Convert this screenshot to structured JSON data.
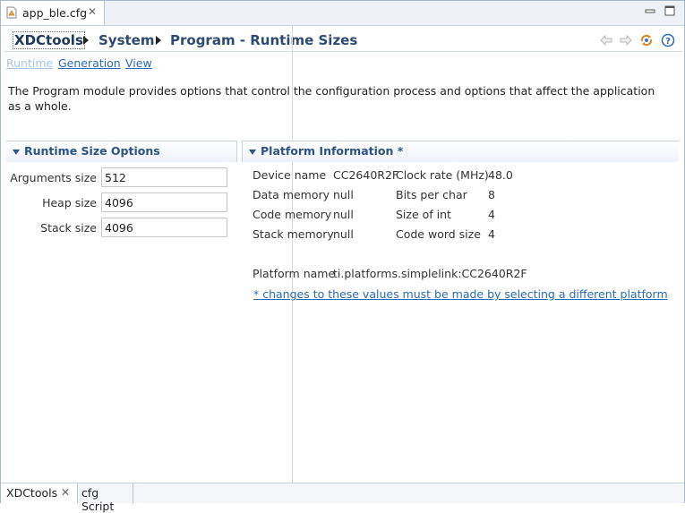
{
  "editor_tab": {
    "label": "app_ble.cfg",
    "close_glyph": "✕"
  },
  "breadcrumb": {
    "items": [
      "XDCtools",
      "System",
      "Program - Runtime Sizes"
    ]
  },
  "header_icons": [
    "back-arrow-icon",
    "forward-arrow-icon",
    "sync-icon",
    "help-icon"
  ],
  "links": [
    "Runtime",
    "Generation",
    "View"
  ],
  "description": "The Program module provides options that control the configuration process and options that affect the application as a whole.",
  "runtime_section": {
    "title": "Runtime Size Options",
    "fields": [
      {
        "label": "Arguments size",
        "value": "512"
      },
      {
        "label": "Heap size",
        "value": "4096"
      },
      {
        "label": "Stack size",
        "value": "4096"
      }
    ]
  },
  "platform_section": {
    "title": "Platform Information *",
    "rows": [
      {
        "label": "Device name",
        "value": "CC2640R2F",
        "label2": "Clock rate (MHz)",
        "value2": "48.0"
      },
      {
        "label": "Data memory",
        "value": "null",
        "label2": "Bits per char",
        "value2": "8"
      },
      {
        "label": "Code memory",
        "value": "null",
        "label2": "Size of int",
        "value2": "4"
      },
      {
        "label": "Stack memory",
        "value": "null",
        "label2": "Code word size",
        "value2": "4"
      }
    ],
    "platform_name_label": "Platform name",
    "platform_name_value": "ti.platforms.simplelink:CC2640R2F",
    "note": "* changes to these values must be made by selecting a different platform"
  },
  "bottom_tabs": [
    "XDCtools",
    "cfg Script"
  ],
  "colors": {
    "link": "#2a6bb8",
    "link_disabled": "#a7c4e6",
    "heading": "#2d5284",
    "border": "#c7d3e1"
  }
}
